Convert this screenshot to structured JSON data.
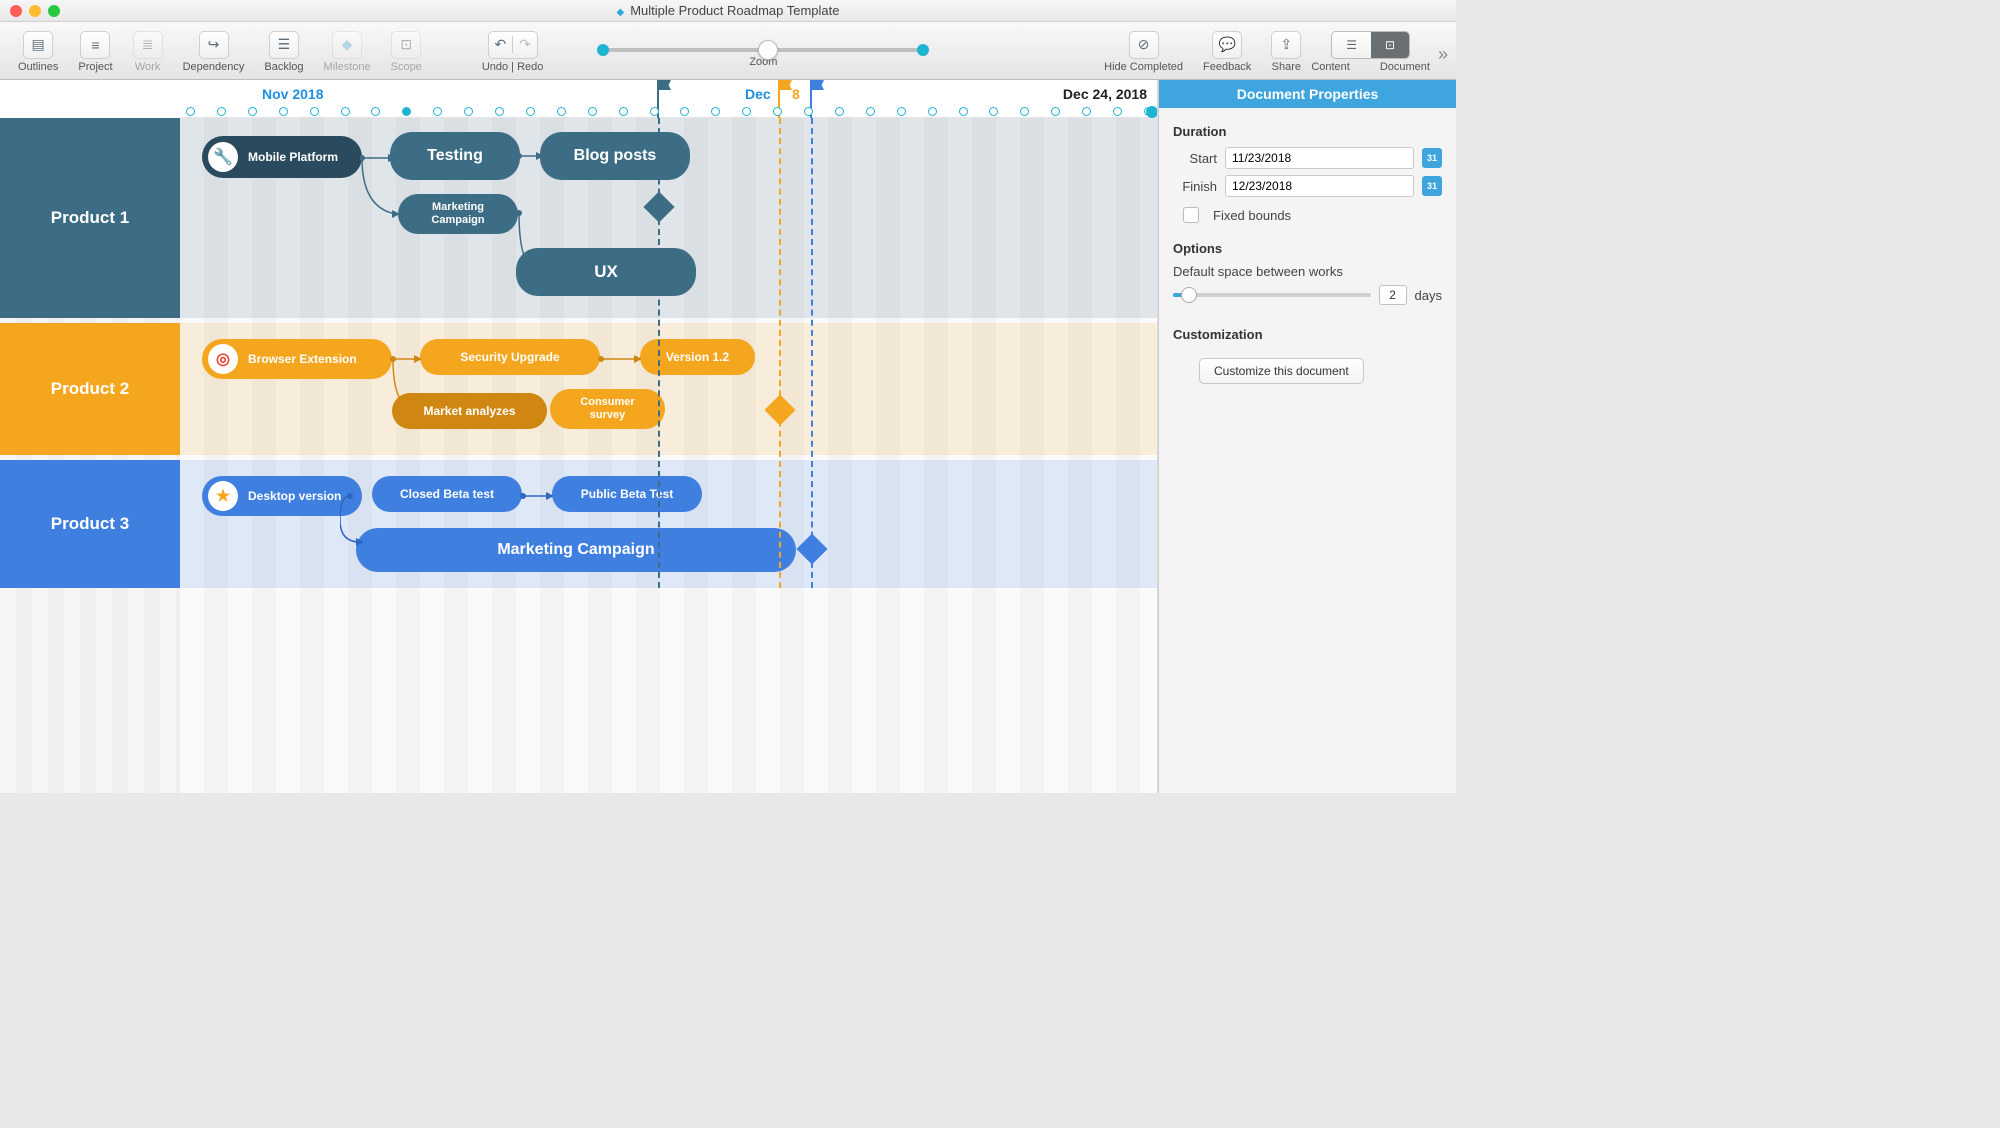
{
  "window": {
    "title": "Multiple Product Roadmap Template"
  },
  "toolbar": {
    "outlines": "Outlines",
    "project": "Project",
    "work": "Work",
    "dependency": "Dependency",
    "backlog": "Backlog",
    "milestone": "Milestone",
    "scope": "Scope",
    "undoRedo": "Undo | Redo",
    "zoom": "Zoom",
    "hideCompleted": "Hide Completed",
    "feedback": "Feedback",
    "share": "Share",
    "segContent": "Content",
    "segDocument": "Document"
  },
  "timeline": {
    "month1": "Nov 2018",
    "month2": "Dec",
    "endDate": "Dec 24, 2018",
    "flag2extra": "8"
  },
  "lanes": {
    "product1": "Product 1",
    "product2": "Product 2",
    "product3": "Product 3"
  },
  "tasks": {
    "p1_head": "Mobile Platform",
    "p1_testing": "Testing",
    "p1_blog": "Blog posts",
    "p1_marketing1": "Marketing",
    "p1_marketing2": "Campaign",
    "p1_ux": "UX",
    "p2_head": "Browser Extension",
    "p2_sec": "Security Upgrade",
    "p2_ver": "Version 1.2",
    "p2_market": "Market analyzes",
    "p2_consumer1": "Consumer",
    "p2_consumer2": "survey",
    "p3_head": "Desktop version",
    "p3_closed": "Closed Beta test",
    "p3_public": "Public Beta Test",
    "p3_marketing": "Marketing Campaign"
  },
  "panel": {
    "title": "Document Properties",
    "duration": "Duration",
    "start_lbl": "Start",
    "start_val": "11/23/2018",
    "finish_lbl": "Finish",
    "finish_val": "12/23/2018",
    "fixed": "Fixed bounds",
    "options": "Options",
    "spacing_lbl": "Default space between works",
    "spacing_val": "2",
    "spacing_unit": "days",
    "customization": "Customization",
    "customize_btn": "Customize this document"
  }
}
